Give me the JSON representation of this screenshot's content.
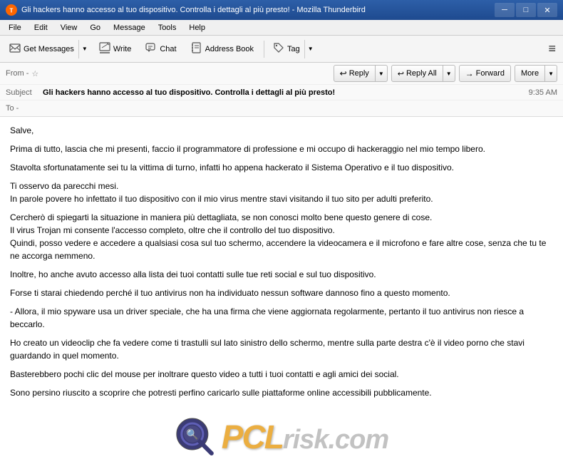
{
  "window": {
    "title": "Gli hackers hanno accesso al tuo dispositivo. Controlla i dettagli al più presto! - Mozilla Thunderbird",
    "app_icon": "🦅"
  },
  "menu": {
    "items": [
      "File",
      "Edit",
      "View",
      "Go",
      "Message",
      "Tools",
      "Help"
    ]
  },
  "toolbar": {
    "get_messages_label": "Get Messages",
    "write_label": "Write",
    "chat_label": "Chat",
    "address_book_label": "Address Book",
    "tag_label": "Tag",
    "menu_icon": "≡"
  },
  "email_header": {
    "from_label": "From -",
    "subject_label": "Subject",
    "to_label": "To -",
    "from_value": "",
    "subject_value": "Gli hackers hanno accesso al tuo dispositivo. Controlla i dettagli al più presto!",
    "to_value": "",
    "timestamp": "9:35 AM"
  },
  "action_buttons": {
    "reply_label": "Reply",
    "reply_all_label": "Reply All",
    "forward_label": "Forward",
    "more_label": "More"
  },
  "email_body": {
    "paragraphs": [
      "Salve,",
      "Prima di tutto, lascia che mi presenti, faccio il programmatore di professione e mi occupo di hackeraggio nel mio tempo libero.",
      "Stavolta sfortunatamente sei tu la vittima di turno, infatti ho appena hackerato il Sistema Operativo e il tuo dispositivo.",
      "Ti osservo da parecchi mesi.\nIn parole povere ho infettato il tuo dispositivo con il mio virus mentre stavi visitando il tuo sito per adulti preferito.",
      "Cercherò di spiegarti la situazione in maniera più dettagliata, se non conosci molto bene questo genere di cose.\nIl virus Trojan mi consente l'accesso completo, oltre che il controllo del tuo dispositivo.\nQuindi, posso vedere e accedere a qualsiasi cosa sul tuo schermo, accendere la videocamera e il microfono e fare altre cose, senza che tu te ne accorga nemmeno.",
      "Inoltre, ho anche avuto accesso alla lista dei tuoi contatti sulle tue reti social e sul tuo dispositivo.",
      "Forse ti starai chiedendo perché il tuo antivirus non ha individuato nessun software dannoso fino a questo momento.",
      "- Allora, il mio spyware usa un driver speciale, che ha una firma che viene aggiornata regolarmente, pertanto il tuo antivirus non riesce a beccarlo.",
      "Ho creato un videoclip che fa vedere come ti trastulli sul lato sinistro dello schermo, mentre sulla parte destra c'è il video porno che stavi guardando in quel momento.",
      "Basterebbero pochi clic del mouse per inoltrare questo video a tutti i tuoi contatti e agli amici dei social.",
      "Sono persino riuscito a scoprire che potresti perfino caricarlo sulle piattaforme online accessibili pubblicamente."
    ]
  },
  "watermark": {
    "text": "PCL",
    "suffix": "risk.com"
  },
  "icons": {
    "get_messages": "📥",
    "write": "✏️",
    "chat": "💬",
    "address_book": "📖",
    "tag": "🏷️",
    "reply": "↩",
    "reply_all": "↩↩",
    "forward": "→",
    "star": "☆",
    "dropdown": "▼",
    "minimize": "─",
    "maximize": "□",
    "close": "✕",
    "scroll_up": "▲",
    "scroll_down": "▼"
  },
  "colors": {
    "title_bar": "#2d5fa8",
    "toolbar_bg": "#f5f5f5",
    "accent": "#ff6600"
  }
}
